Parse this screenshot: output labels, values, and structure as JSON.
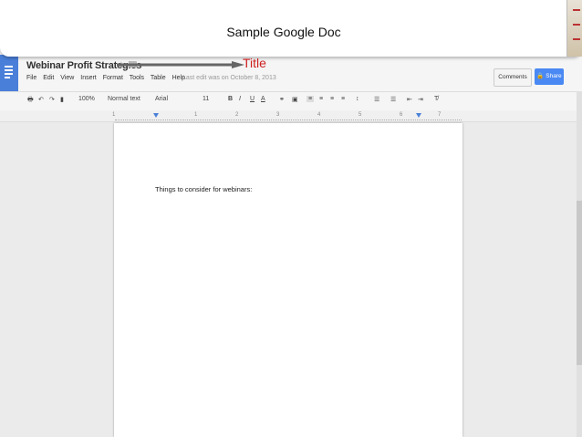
{
  "caption": "Sample Google Doc",
  "callout": {
    "label": "Title",
    "color": "#cc1f1f"
  },
  "doc": {
    "title": "Webinar Profit Strategies",
    "last_edit": "Last edit was on October 8, 2013",
    "menu": [
      "File",
      "Edit",
      "View",
      "Insert",
      "Format",
      "Tools",
      "Table",
      "Help"
    ]
  },
  "buttons": {
    "comments": "Comments",
    "share": "Share"
  },
  "toolbar": {
    "zoom": "100%",
    "style": "Normal text",
    "font": "Arial",
    "size": "11"
  },
  "ruler": [
    "1",
    "1",
    "2",
    "3",
    "4",
    "5",
    "6",
    "7"
  ],
  "page": {
    "text": "Things to consider for webinars:"
  },
  "colors": {
    "accent": "#4a89f3",
    "docs_blue": "#4a7fd9"
  }
}
